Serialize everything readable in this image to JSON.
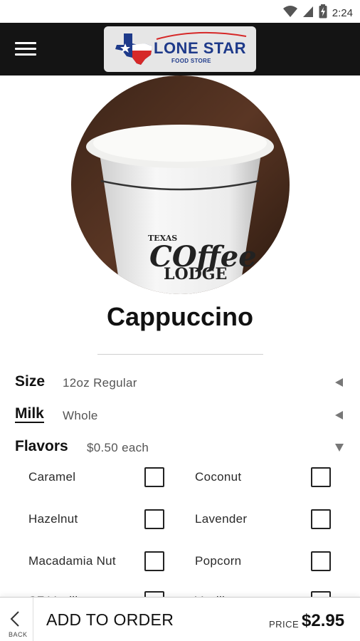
{
  "status_bar": {
    "time": "2:24",
    "icons": [
      "wifi-icon",
      "signal-icon",
      "battery-icon"
    ]
  },
  "app_bar": {
    "menu_icon": "hamburger-menu-icon",
    "logo": {
      "brand": "LONE STAR",
      "subtitle": "FOOD STORE"
    }
  },
  "product": {
    "title": "Cappuccino",
    "image": "cappuccino-cup-photo"
  },
  "options": {
    "size": {
      "label": "Size",
      "value": "12oz Regular"
    },
    "milk": {
      "label": "Milk",
      "value": "Whole"
    },
    "flavors": {
      "label": "Flavors",
      "value": "$0.50 each"
    }
  },
  "flavor_items": [
    {
      "name": "Caramel",
      "checked": false
    },
    {
      "name": "Coconut",
      "checked": false
    },
    {
      "name": "Hazelnut",
      "checked": false
    },
    {
      "name": "Lavender",
      "checked": false
    },
    {
      "name": "Macadamia Nut",
      "checked": false
    },
    {
      "name": "Popcorn",
      "checked": false
    },
    {
      "name": "SF Vanilla",
      "checked": false
    },
    {
      "name": "Vanilla",
      "checked": false
    }
  ],
  "bottom_bar": {
    "back_label": "BACK",
    "add_label": "ADD TO ORDER",
    "price_label": "PRICE",
    "price_value": "$2.95"
  },
  "colors": {
    "app_bar_bg": "#141414",
    "logo_bg": "#e6e6e6",
    "logo_blue": "#1e3a8a",
    "logo_red": "#d62828"
  }
}
